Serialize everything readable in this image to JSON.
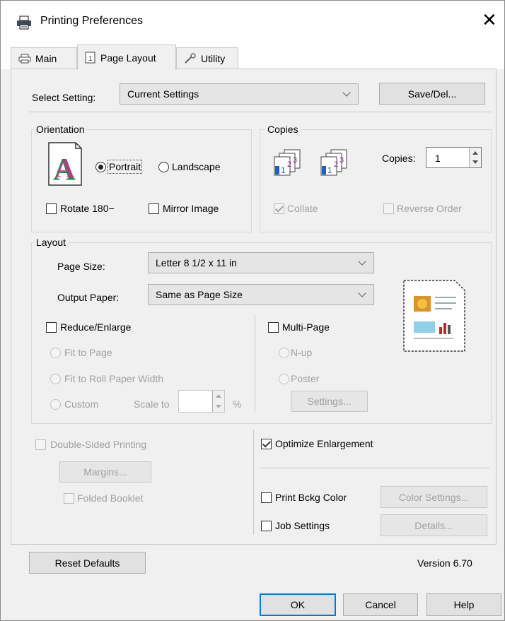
{
  "window": {
    "title": "Printing Preferences",
    "close_icon": "close-icon"
  },
  "tabs": [
    {
      "label": "Main",
      "icon": "printer-icon"
    },
    {
      "label": "Page Layout",
      "icon": "page-layout-icon",
      "active": true
    },
    {
      "label": "Utility",
      "icon": "wrench-icon"
    }
  ],
  "select_setting": {
    "label": "Select Setting:",
    "value": "Current Settings",
    "save_button": "Save/Del..."
  },
  "orientation": {
    "group_label": "Orientation",
    "portrait": "Portrait",
    "landscape": "Landscape",
    "selected": "Portrait",
    "rotate": "Rotate 180−",
    "mirror": "Mirror Image"
  },
  "copies": {
    "group_label": "Copies",
    "copies_label": "Copies:",
    "copies_value": "1",
    "collate": "Collate",
    "collate_checked": true,
    "reverse_order": "Reverse Order"
  },
  "layout": {
    "group_label": "Layout",
    "page_size_label": "Page Size:",
    "page_size_value": "Letter 8 1/2 x 11 in",
    "output_paper_label": "Output Paper:",
    "output_paper_value": "Same as Page Size",
    "reduce_enlarge": "Reduce/Enlarge",
    "fit_to_page": "Fit to Page",
    "fit_to_roll": "Fit to Roll Paper Width",
    "custom": "Custom",
    "scale_to": "Scale to",
    "percent": "%",
    "multi_page": "Multi-Page",
    "n_up": "N-up",
    "poster": "Poster",
    "settings_button": "Settings..."
  },
  "double_sided": {
    "label": "Double-Sided Printing",
    "margins_button": "Margins...",
    "folded_booklet": "Folded Booklet"
  },
  "optimize": {
    "label": "Optimize Enlargement",
    "checked": true
  },
  "print_bckg": {
    "label": "Print Bckg Color",
    "button": "Color Settings..."
  },
  "job_settings": {
    "label": "Job Settings",
    "button": "Details..."
  },
  "footer": {
    "reset_button": "Reset Defaults",
    "version": "Version 6.70",
    "ok": "OK",
    "cancel": "Cancel",
    "help": "Help"
  },
  "colors": {
    "accent": "#0078d7",
    "disabled_text": "#a0a0a0"
  }
}
